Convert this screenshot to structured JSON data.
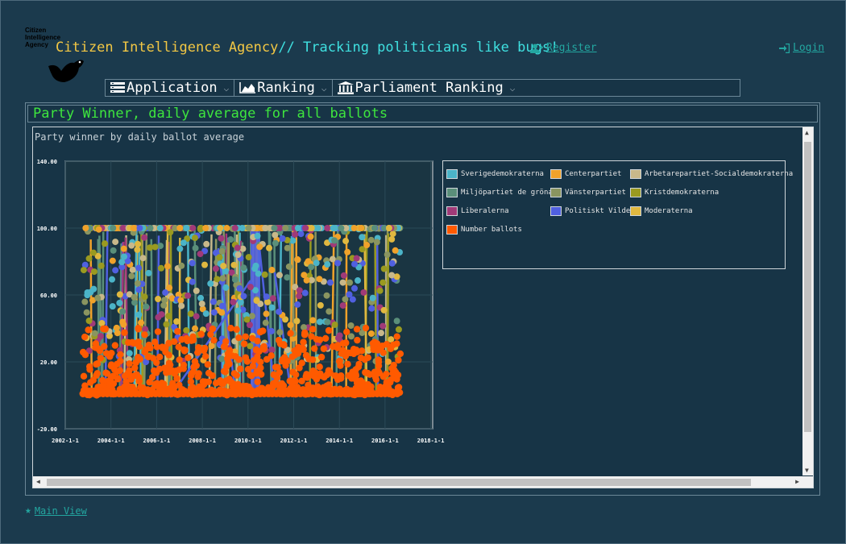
{
  "header": {
    "logo_text": [
      "Citizen",
      "Intelligence",
      "Agency"
    ],
    "title_brand": "Citizen Intelligence Agency",
    "title_tagline": "// Tracking politicians like bugs!",
    "register_label": "Register",
    "login_label": "Login"
  },
  "menu": [
    {
      "label": "Application",
      "icon": "list-icon"
    },
    {
      "label": "Ranking",
      "icon": "area-chart-icon"
    },
    {
      "label": "Parliament Ranking",
      "icon": "institution-icon"
    }
  ],
  "panel": {
    "title": "Party Winner, daily average for all ballots"
  },
  "chart_data": {
    "type": "line",
    "title": "Party winner by daily ballot average",
    "ylim": [
      -20,
      140
    ],
    "yticks": [
      "140.00",
      "100.00",
      "60.00",
      "20.00",
      "-20.00"
    ],
    "xticks": [
      "2002-1-1",
      "2004-1-1",
      "2006-1-1",
      "2008-1-1",
      "2010-1-1",
      "2012-1-1",
      "2014-1-1",
      "2016-1-1",
      "2018-1-1"
    ],
    "grid": true,
    "legend_position": "top-right",
    "series": [
      {
        "name": "Sverigedemokraterna",
        "color": "#4bb4c8"
      },
      {
        "name": "Centerpartiet",
        "color": "#f0a22a"
      },
      {
        "name": "Arbetarepartiet-Socialdemokraterna",
        "color": "#c8b88a"
      },
      {
        "name": "Miljöpartiet de gröna",
        "color": "#5a8f7a"
      },
      {
        "name": "Vänsterpartiet",
        "color": "#8a9560"
      },
      {
        "name": "Kristdemokraterna",
        "color": "#9a9a20"
      },
      {
        "name": "Liberalerna",
        "color": "#a03a78"
      },
      {
        "name": "Politiskt Vilde",
        "color": "#5060e0"
      },
      {
        "name": "Moderaterna",
        "color": "#e0b840"
      },
      {
        "name": "Number ballots",
        "color": "#ff5a00"
      }
    ]
  },
  "footer": {
    "main_view_label": "Main View"
  }
}
